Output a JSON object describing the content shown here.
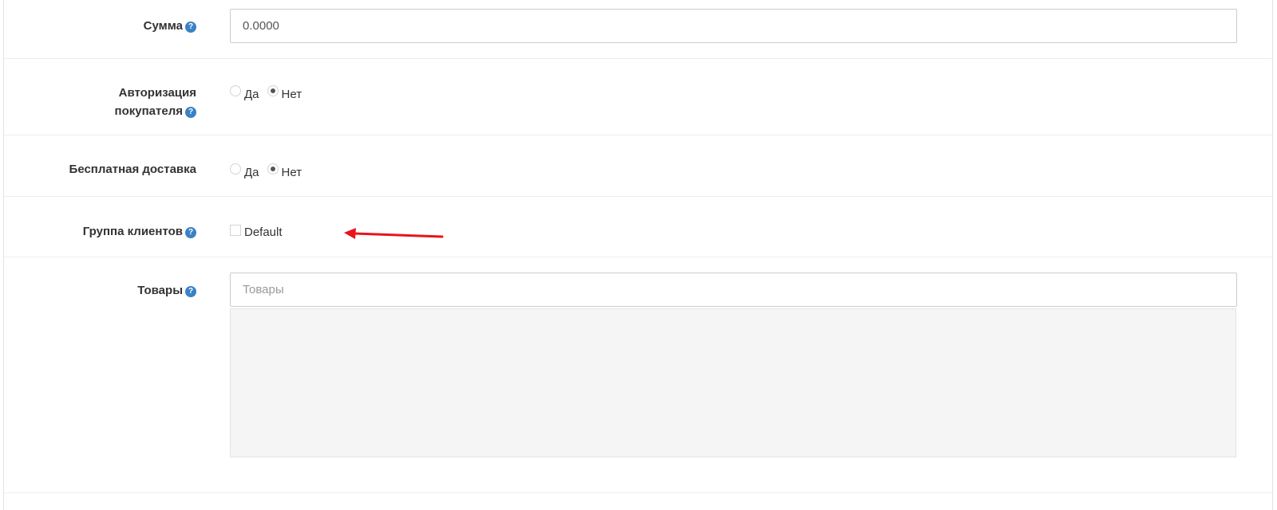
{
  "form": {
    "amount": {
      "label": "Сумма",
      "value": "0.0000"
    },
    "customer_login": {
      "label_line1": "Авторизация",
      "label_line2": "покупателя",
      "options": [
        "Да",
        "Нет"
      ],
      "selected": "Нет"
    },
    "free_shipping": {
      "label": "Бесплатная доставка",
      "options": [
        "Да",
        "Нет"
      ],
      "selected": "Нет"
    },
    "customer_group": {
      "label": "Группа клиентов",
      "option_label": "Default",
      "checked": false
    },
    "products": {
      "label": "Товары",
      "placeholder": "Товары",
      "value": ""
    }
  },
  "icons": {
    "help": "question-circle-icon",
    "annotation": "red-arrow-icon"
  },
  "colors": {
    "help_icon": "#3a82c4",
    "annotation_arrow": "#e8141c",
    "products_box_bg": "#f5f5f5"
  }
}
